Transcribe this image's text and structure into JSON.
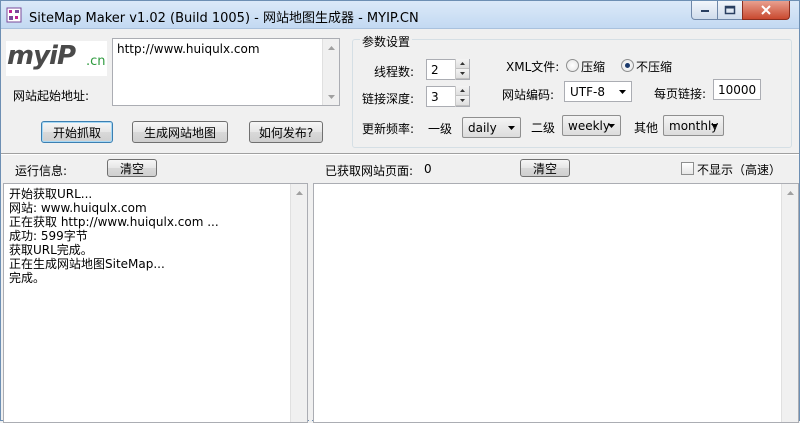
{
  "window": {
    "title": "SiteMap Maker v1.02 (Build 1005) - 网站地图生成器 - MYIP.CN"
  },
  "logo": {
    "text_main": "myiP",
    "text_suffix": ".cn"
  },
  "start_url": {
    "label": "网站起始地址:",
    "value": "http://www.huiqulx.com"
  },
  "buttons": {
    "start_crawl": "开始抓取",
    "generate_map": "生成网站地图",
    "how_publish": "如何发布?"
  },
  "settings": {
    "group_title": "参数设置",
    "threads_label": "线程数:",
    "threads_value": "2",
    "depth_label": "链接深度:",
    "depth_value": "3",
    "xml_label": "XML文件:",
    "xml_options": [
      "压缩",
      "不压缩"
    ],
    "xml_selected": "不压缩",
    "encoding_label": "网站编码:",
    "encoding_value": "UTF-8",
    "per_page_label": "每页链接:",
    "per_page_value": "10000",
    "freq_label": "更新频率:",
    "level1_label": "一级",
    "level1_value": "daily",
    "level2_label": "二级",
    "level2_value": "weekly",
    "other_label": "其他",
    "other_value": "monthly"
  },
  "log_panel": {
    "label": "运行信息:",
    "clear_button": "清空",
    "lines": [
      "开始获取URL...",
      "网站: www.huiqulx.com",
      "正在获取 http://www.huiqulx.com ...",
      "成功: 599字节",
      "获取URL完成。",
      "正在生成网站地图SiteMap...",
      "完成。"
    ]
  },
  "pages_panel": {
    "label": "已获取网站页面:",
    "count": "0",
    "clear_button": "清空",
    "hide_checkbox_label": "不显示（高速）",
    "hide_checked": false
  }
}
